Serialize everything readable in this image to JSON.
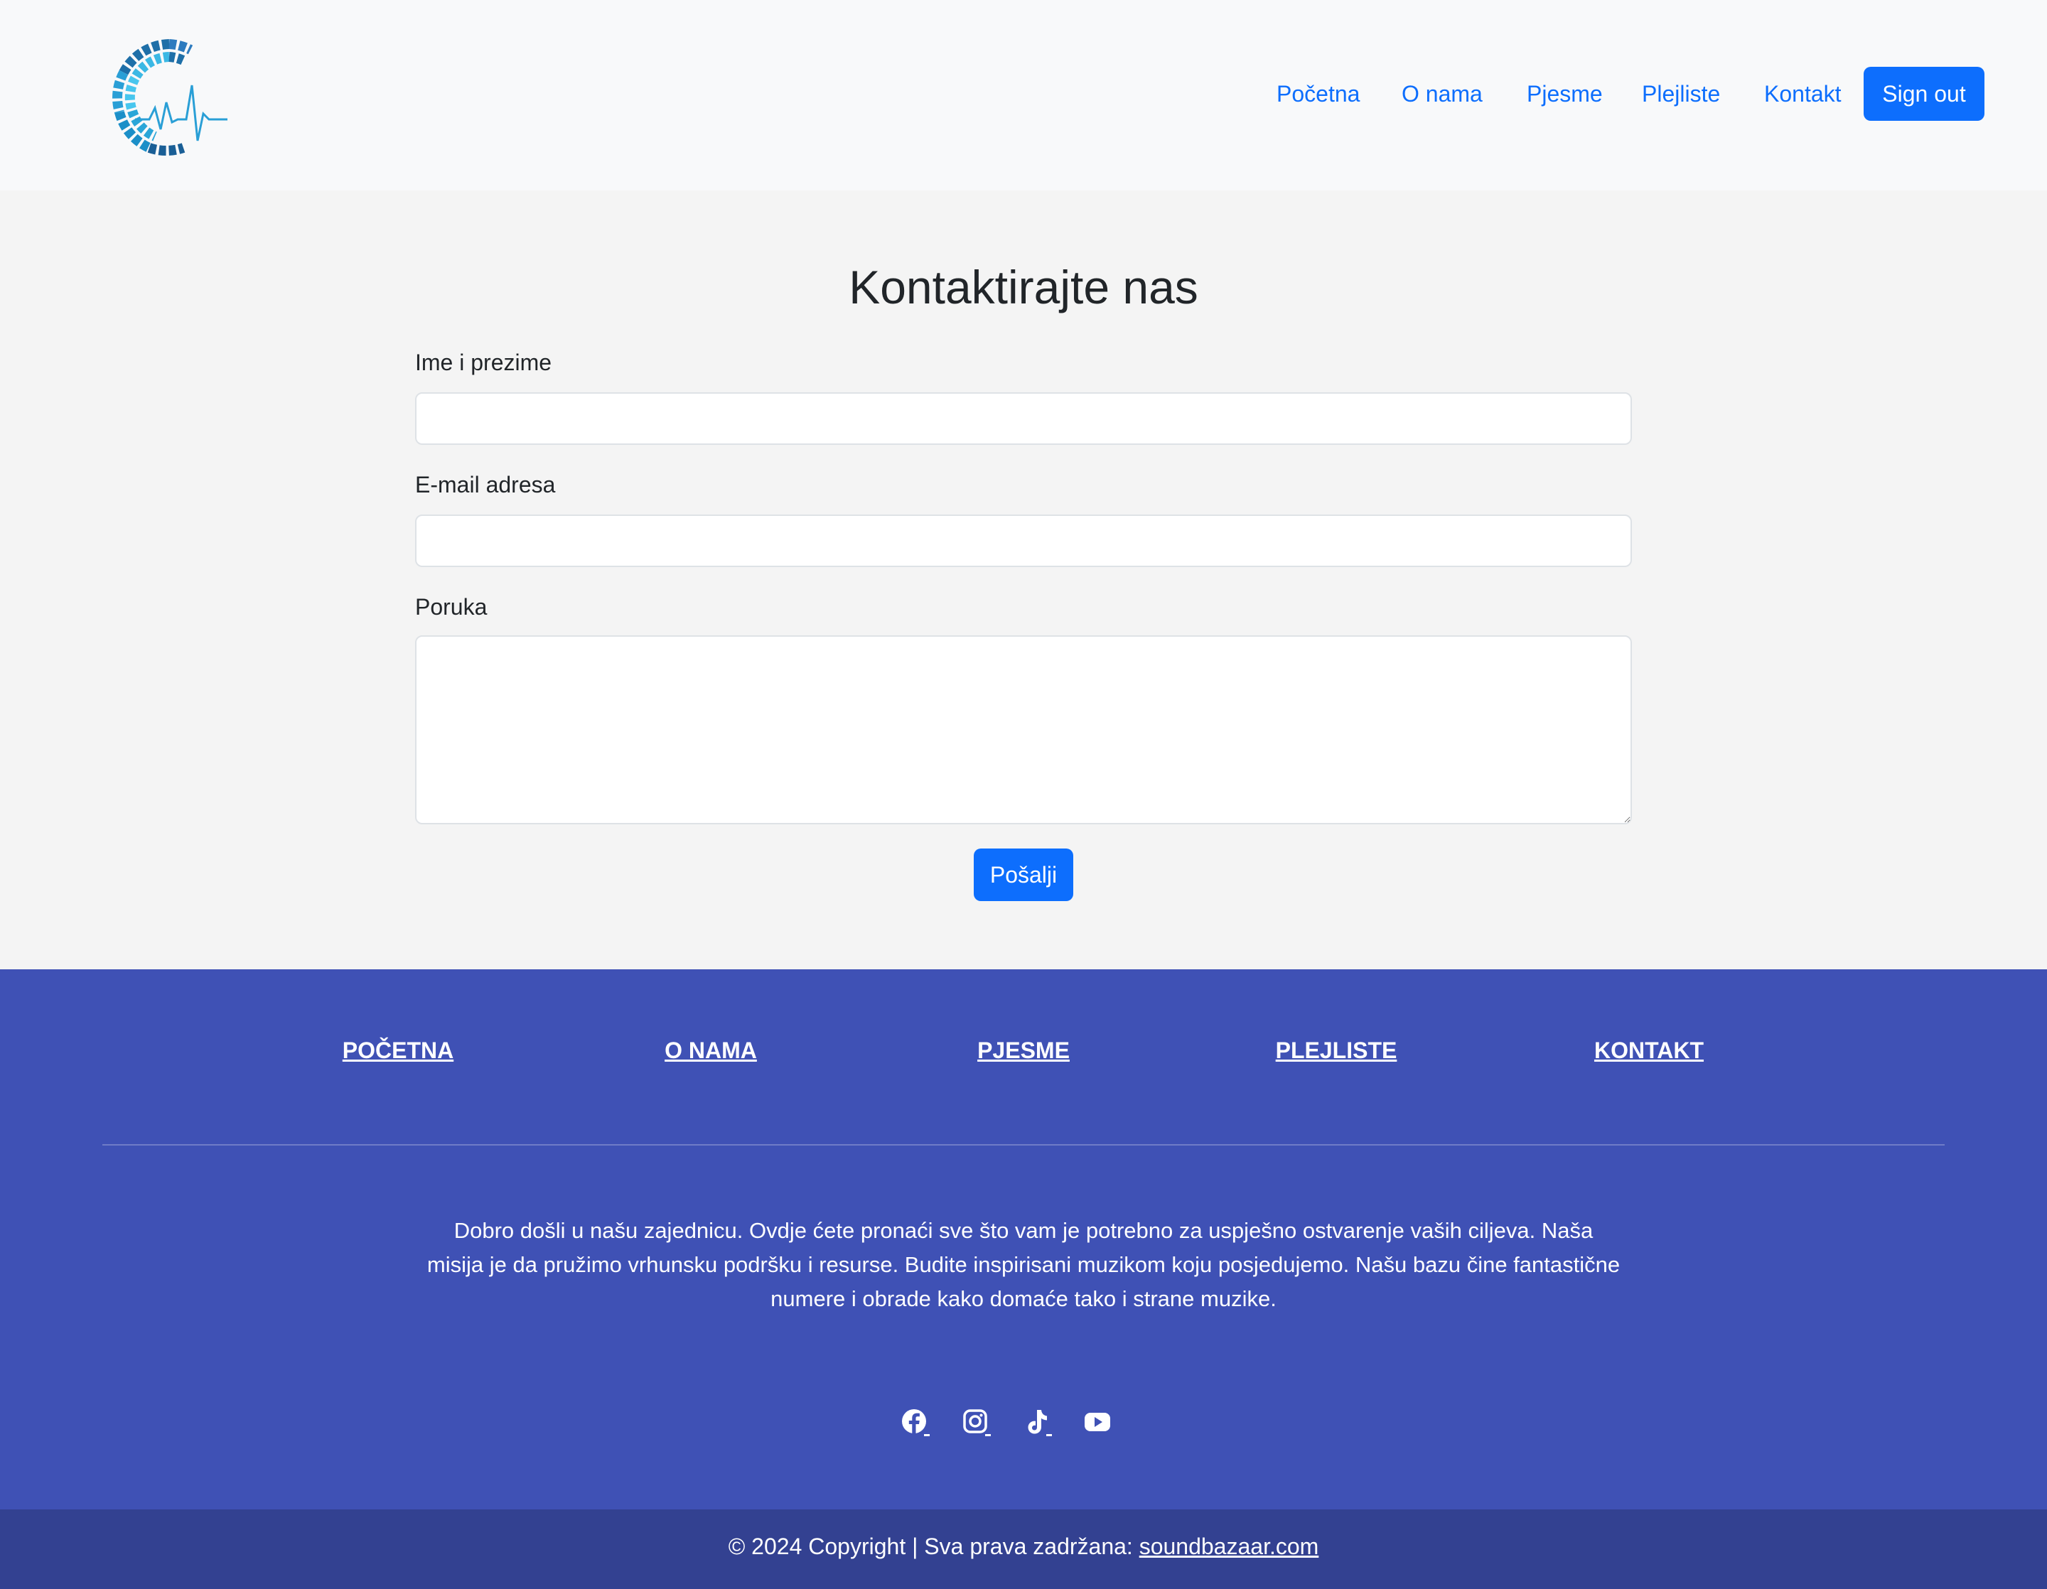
{
  "nav": {
    "links": [
      "Početna",
      "O nama",
      "Pjesme",
      "Plejliste",
      "Kontakt"
    ],
    "signout_label": "Sign out"
  },
  "contact": {
    "title": "Kontaktirajte nas",
    "name_label": "Ime i prezime",
    "email_label": "E-mail adresa",
    "message_label": "Poruka",
    "name_value": "",
    "email_value": "",
    "message_value": "",
    "submit_label": "Pošalji"
  },
  "footer": {
    "links": [
      "POČETNA",
      "O NAMA",
      "PJESME",
      "PLEJLISTE",
      "KONTAKT"
    ],
    "description": "Dobro došli u našu zajednicu. Ovdje ćete pronaći sve što vam je potrebno za uspješno ostvarenje vaših ciljeva. Naša misija je da pružimo vrhunsku podršku i resurse. Budite inspirisani muzikom koju posjedujemo. Našu bazu čine fantastične numere i obrade kako domaće tako i strane muzike.",
    "social_icons": [
      "facebook-icon",
      "instagram-icon",
      "tiktok-icon",
      "youtube-icon"
    ],
    "copyright_text": "© 2024 Copyright | Sva prava zadržana: ",
    "copyright_link": "soundbazaar.com"
  },
  "colors": {
    "primary": "#0d6efd",
    "footer_bg": "#3f51b5",
    "copyright_bg": "#334191",
    "nav_bg": "#f8f9fa",
    "page_bg": "#f4f4f4"
  }
}
